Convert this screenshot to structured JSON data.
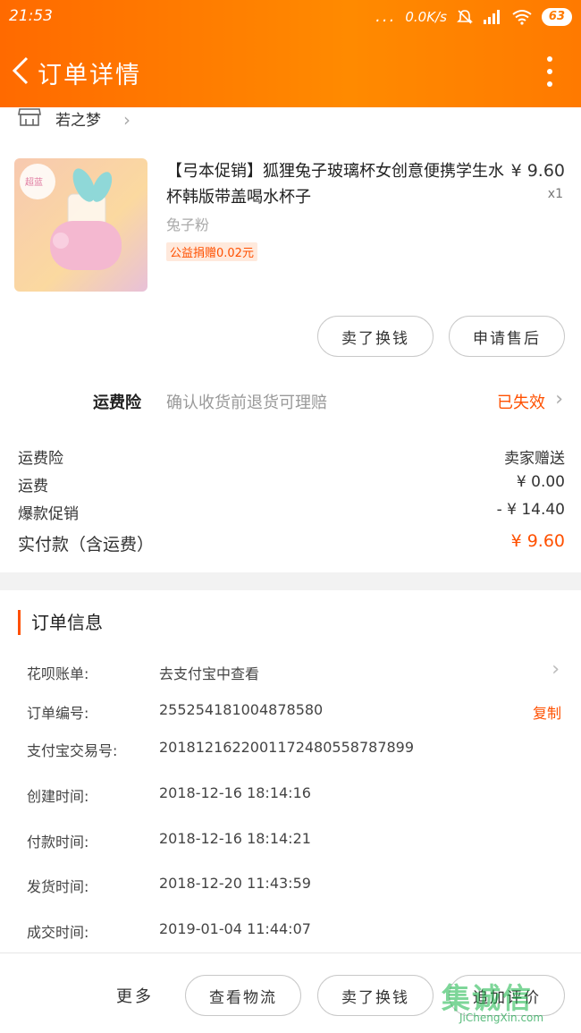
{
  "status_bar": {
    "time": "21:53",
    "signal_dots": "...",
    "net_speed": "0.0K/s",
    "battery": "63"
  },
  "nav": {
    "title": "订单详情"
  },
  "shop": {
    "name": "若之梦"
  },
  "product": {
    "title": "【弓本促销】狐狸兔子玻璃杯女创意便携学生水杯韩版带盖喝水杯子",
    "price": "¥ 9.60",
    "qty": "x1",
    "spec": "兔子粉",
    "charity_tag": "公益捐赠0.02元",
    "image_text": "超蓝"
  },
  "item_actions": {
    "sell_label": "卖了换钱",
    "after_sale_label": "申请售后"
  },
  "insurance": {
    "label": "运费险",
    "desc": "确认收货前退货可理赔",
    "status": "已失效"
  },
  "fees": {
    "rows": [
      {
        "label": "运费险",
        "value": "卖家赠送"
      },
      {
        "label": "运费",
        "value": "¥ 0.00"
      },
      {
        "label": "爆款促销",
        "value": "- ¥ 14.40"
      }
    ],
    "total_label": "实付款（含运费）",
    "total_value": "¥ 9.60"
  },
  "order_info": {
    "section_title": "订单信息",
    "huabei_label": "花呗账单:",
    "huabei_value": "去支付宝中查看",
    "order_no_label": "订单编号:",
    "order_no_value": "255254181004878580",
    "copy_label": "复制",
    "alipay_no_label": "支付宝交易号:",
    "alipay_no_value": "2018121622001172480558787899",
    "created_label": "创建时间:",
    "created_value": "2018-12-16 18:14:16",
    "paid_label": "付款时间:",
    "paid_value": "2018-12-16 18:14:21",
    "shipped_label": "发货时间:",
    "shipped_value": "2018-12-20 11:43:59",
    "done_label": "成交时间:",
    "done_value": "2019-01-04 11:44:07"
  },
  "bottom": {
    "more_label": "更多",
    "logistics_label": "查看物流",
    "sell_label": "卖了换钱",
    "review_label": "追加评价"
  },
  "watermark": {
    "main": "集诚信",
    "sub": "JiChengXin.com"
  },
  "colors": {
    "accent": "#ff5000",
    "topbar": "#ff7a00"
  }
}
